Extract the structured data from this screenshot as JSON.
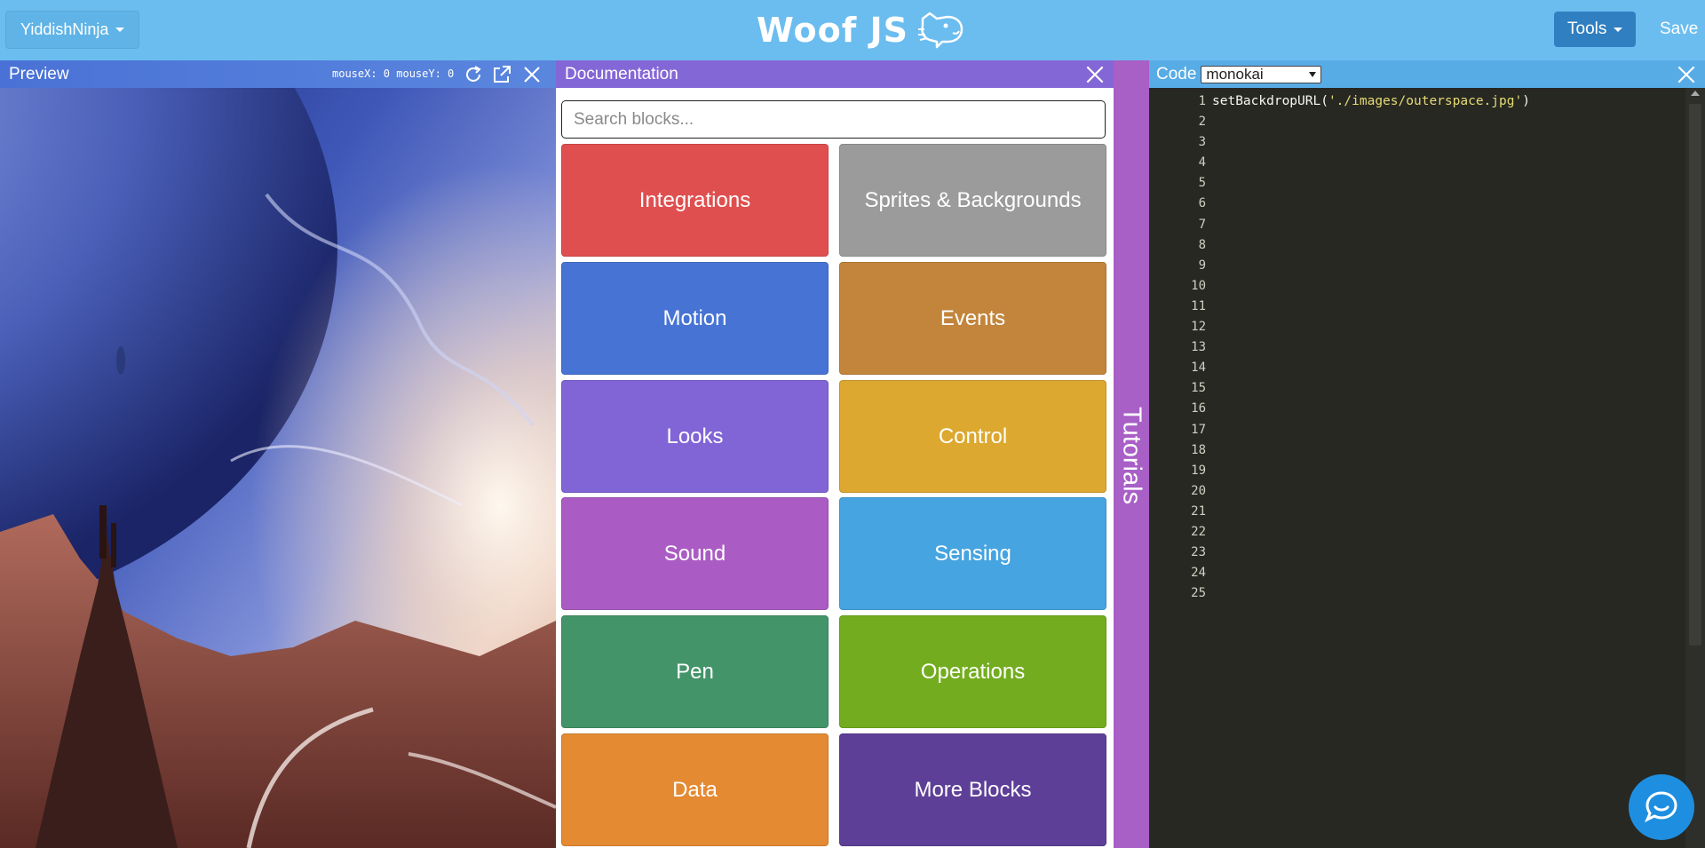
{
  "navbar": {
    "user_label": "YiddishNinja",
    "brand": "Woof JS",
    "tools_label": "Tools",
    "save_label": "Save"
  },
  "preview": {
    "title": "Preview",
    "mouse_readout": "mouseX: 0 mouseY: 0"
  },
  "docs": {
    "title": "Documentation",
    "search_placeholder": "Search blocks...",
    "categories": [
      {
        "label": "Integrations",
        "color": "#e04f4f"
      },
      {
        "label": "Sprites & Backgrounds",
        "color": "#9b9b9b"
      },
      {
        "label": "Motion",
        "color": "#4774d4"
      },
      {
        "label": "Events",
        "color": "#c2853b"
      },
      {
        "label": "Looks",
        "color": "#8165d6"
      },
      {
        "label": "Control",
        "color": "#dca830"
      },
      {
        "label": "Sound",
        "color": "#ab5cc4"
      },
      {
        "label": "Sensing",
        "color": "#46a4e0"
      },
      {
        "label": "Pen",
        "color": "#44946a"
      },
      {
        "label": "Operations",
        "color": "#73ad1f"
      },
      {
        "label": "Data",
        "color": "#e48a33"
      },
      {
        "label": "More Blocks",
        "color": "#5e3f98"
      }
    ]
  },
  "tutorials": {
    "label": "Tutorials"
  },
  "code": {
    "title": "Code",
    "theme": "monokai",
    "line1_fn": "setBackdropURL(",
    "line1_str": "'./images/outerspace.jpg'",
    "line1_end": ")",
    "line_numbers": [
      "1",
      "2",
      "3",
      "4",
      "5",
      "6",
      "7",
      "8",
      "9",
      "10",
      "11",
      "12",
      "13",
      "14",
      "15",
      "16",
      "17",
      "18",
      "19",
      "20",
      "21",
      "22",
      "23",
      "24",
      "25"
    ]
  },
  "colors": {
    "navbar": "#6bbdef",
    "preview_header": "#4a72d6",
    "docs_header": "#8467d6",
    "tutorials": "#a85fc6",
    "code_header": "#58ace6",
    "editor_bg": "#272822"
  },
  "icons": [
    "caret-icon",
    "dog-logo-icon",
    "refresh-icon",
    "external-link-icon",
    "close-icon",
    "chat-icon"
  ]
}
